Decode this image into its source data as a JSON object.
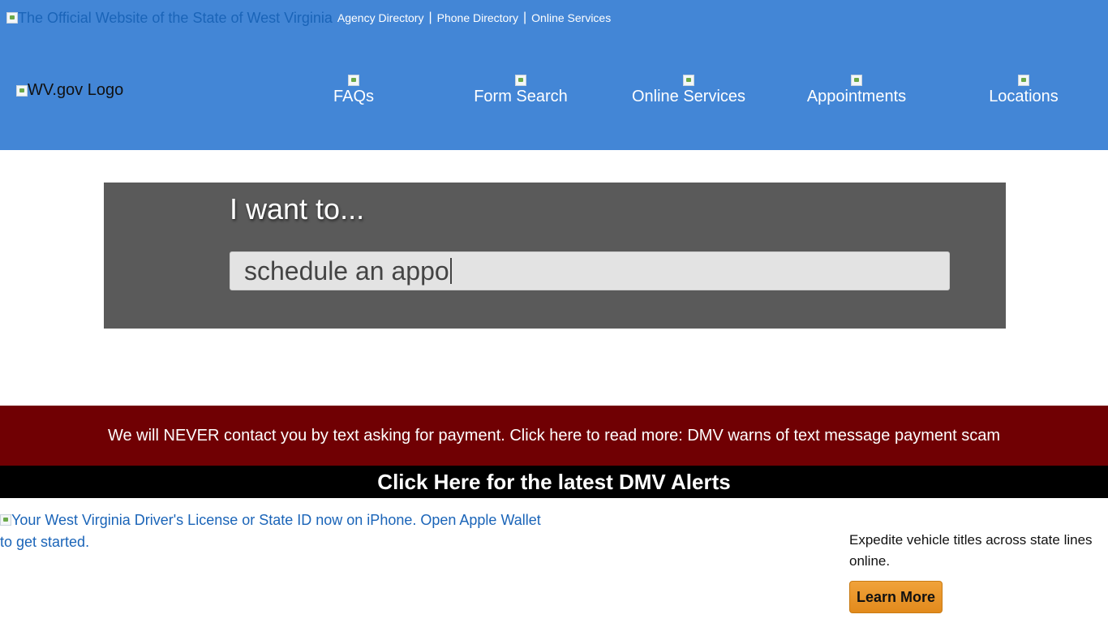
{
  "topbar": {
    "state_site_alt": "The Official Website of the State of West Virginia",
    "links": [
      "Agency Directory",
      "Phone Directory",
      "Online Services"
    ],
    "separator": "|"
  },
  "logo": {
    "alt": "WV.gov Logo"
  },
  "nav": {
    "items": [
      {
        "label": "FAQs",
        "icon": "broken-image-icon"
      },
      {
        "label": "Form Search",
        "icon": "broken-image-icon"
      },
      {
        "label": "Online Services",
        "icon": "broken-image-icon"
      },
      {
        "label": "Appointments",
        "icon": "broken-image-icon"
      },
      {
        "label": "Locations",
        "icon": "broken-image-icon"
      }
    ]
  },
  "search": {
    "heading": "I want to...",
    "value": "schedule an appo"
  },
  "alerts": {
    "scam_notice": "We will NEVER contact you by text asking for payment. Click here to read more: DMV warns of text message payment scam",
    "latest_alerts": "Click Here for the latest DMV Alerts"
  },
  "promo": {
    "wallet_alt": "Your West Virginia Driver's License or State ID now on iPhone. Open Apple Wallet to get started.",
    "expedite_text": "Expedite vehicle titles across state lines online.",
    "learn_more": "Learn More"
  },
  "colors": {
    "header_bg": "#4386d6",
    "search_band_bg": "#5a5a5a",
    "alert_red_bg": "#700003",
    "alert_black_bg": "#000000",
    "link_blue": "#1a64b8",
    "button_orange": "#e8931f"
  }
}
